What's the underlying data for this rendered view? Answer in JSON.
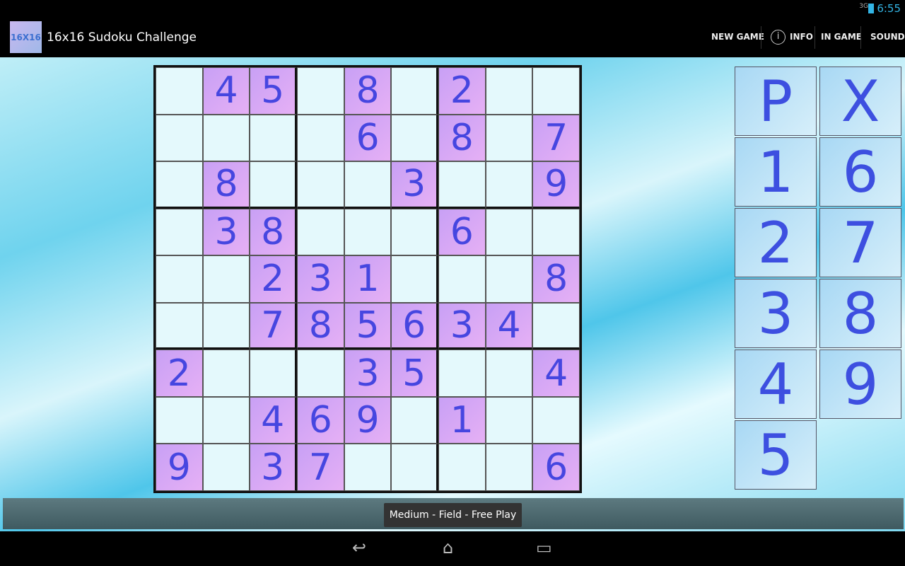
{
  "status": {
    "time": "6:55",
    "network": "3G",
    "icons": [
      "signal-icon",
      "battery-charging-icon"
    ]
  },
  "app": {
    "title": "16x16 Sudoku Challenge",
    "logo_text": "16X16"
  },
  "actions": {
    "new_game": "NEW GAME",
    "info": "INFO",
    "in_game": "IN GAME",
    "sound": "SOUND"
  },
  "grid": [
    [
      "",
      "4",
      "5",
      "",
      "8",
      "",
      "2",
      "",
      ""
    ],
    [
      "",
      "",
      "",
      "",
      "6",
      "",
      "8",
      "",
      "7"
    ],
    [
      "",
      "8",
      "",
      "",
      "",
      "3",
      "",
      "",
      "9"
    ],
    [
      "",
      "3",
      "8",
      "",
      "",
      "",
      "6",
      "",
      ""
    ],
    [
      "",
      "",
      "2",
      "3",
      "1",
      "",
      "",
      "",
      "8"
    ],
    [
      "",
      "",
      "7",
      "8",
      "5",
      "6",
      "3",
      "4",
      ""
    ],
    [
      "2",
      "",
      "",
      "",
      "3",
      "5",
      "",
      "",
      "4"
    ],
    [
      "",
      "",
      "4",
      "6",
      "9",
      "",
      "1",
      "",
      ""
    ],
    [
      "9",
      "",
      "3",
      "7",
      "",
      "",
      "",
      "",
      "6"
    ]
  ],
  "keypad": [
    "P",
    "X",
    "1",
    "6",
    "2",
    "7",
    "3",
    "8",
    "4",
    "9",
    "5"
  ],
  "toast": "Medium - Field - Free Play",
  "nav": {
    "back": "↩",
    "home": "⌂",
    "recents": "▭"
  }
}
